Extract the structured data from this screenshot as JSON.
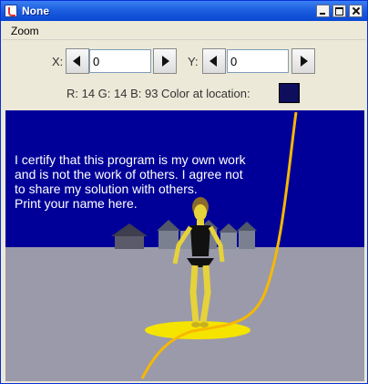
{
  "window": {
    "title": "None"
  },
  "menubar": {
    "items": [
      "Zoom"
    ]
  },
  "coords": {
    "x_label": "X:",
    "x_value": "0",
    "y_label": "Y:",
    "y_value": "0"
  },
  "color_info": {
    "text": "R: 14 G: 14 B: 93 Color at location:",
    "swatch_color": "#0e0e5d"
  },
  "picture": {
    "caption_lines": [
      "I certify that this program is my own work",
      "and is not the work of others. I agree not",
      "to share my solution with others.",
      "Print your name here."
    ],
    "sky_color": "#000099",
    "ground_color": "#9a9aab",
    "curve_color": "#f7b800"
  }
}
